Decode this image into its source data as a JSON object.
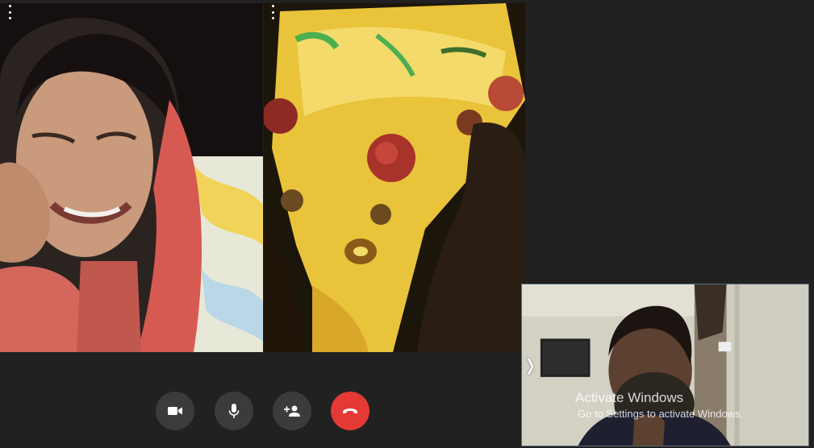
{
  "participants": [
    {
      "name": "",
      "menu_icon": "more-vert-icon"
    },
    {
      "name": "",
      "menu_icon": "more-vert-icon"
    }
  ],
  "self_view": {
    "expand_icon": "chevron-right-icon",
    "expand_glyph": "❭"
  },
  "watermark": {
    "title": "Activate Windows",
    "subtitle": "Go to Settings to activate Windows."
  },
  "controls": {
    "video_icon": "videocam-icon",
    "mic_icon": "mic-icon",
    "add_person_icon": "person-add-icon",
    "end_call_icon": "call-end-icon"
  },
  "colors": {
    "background": "#212121",
    "control_button": "#3b3b3b",
    "end_call": "#e53935",
    "self_view_border": "#5a6b7a"
  }
}
